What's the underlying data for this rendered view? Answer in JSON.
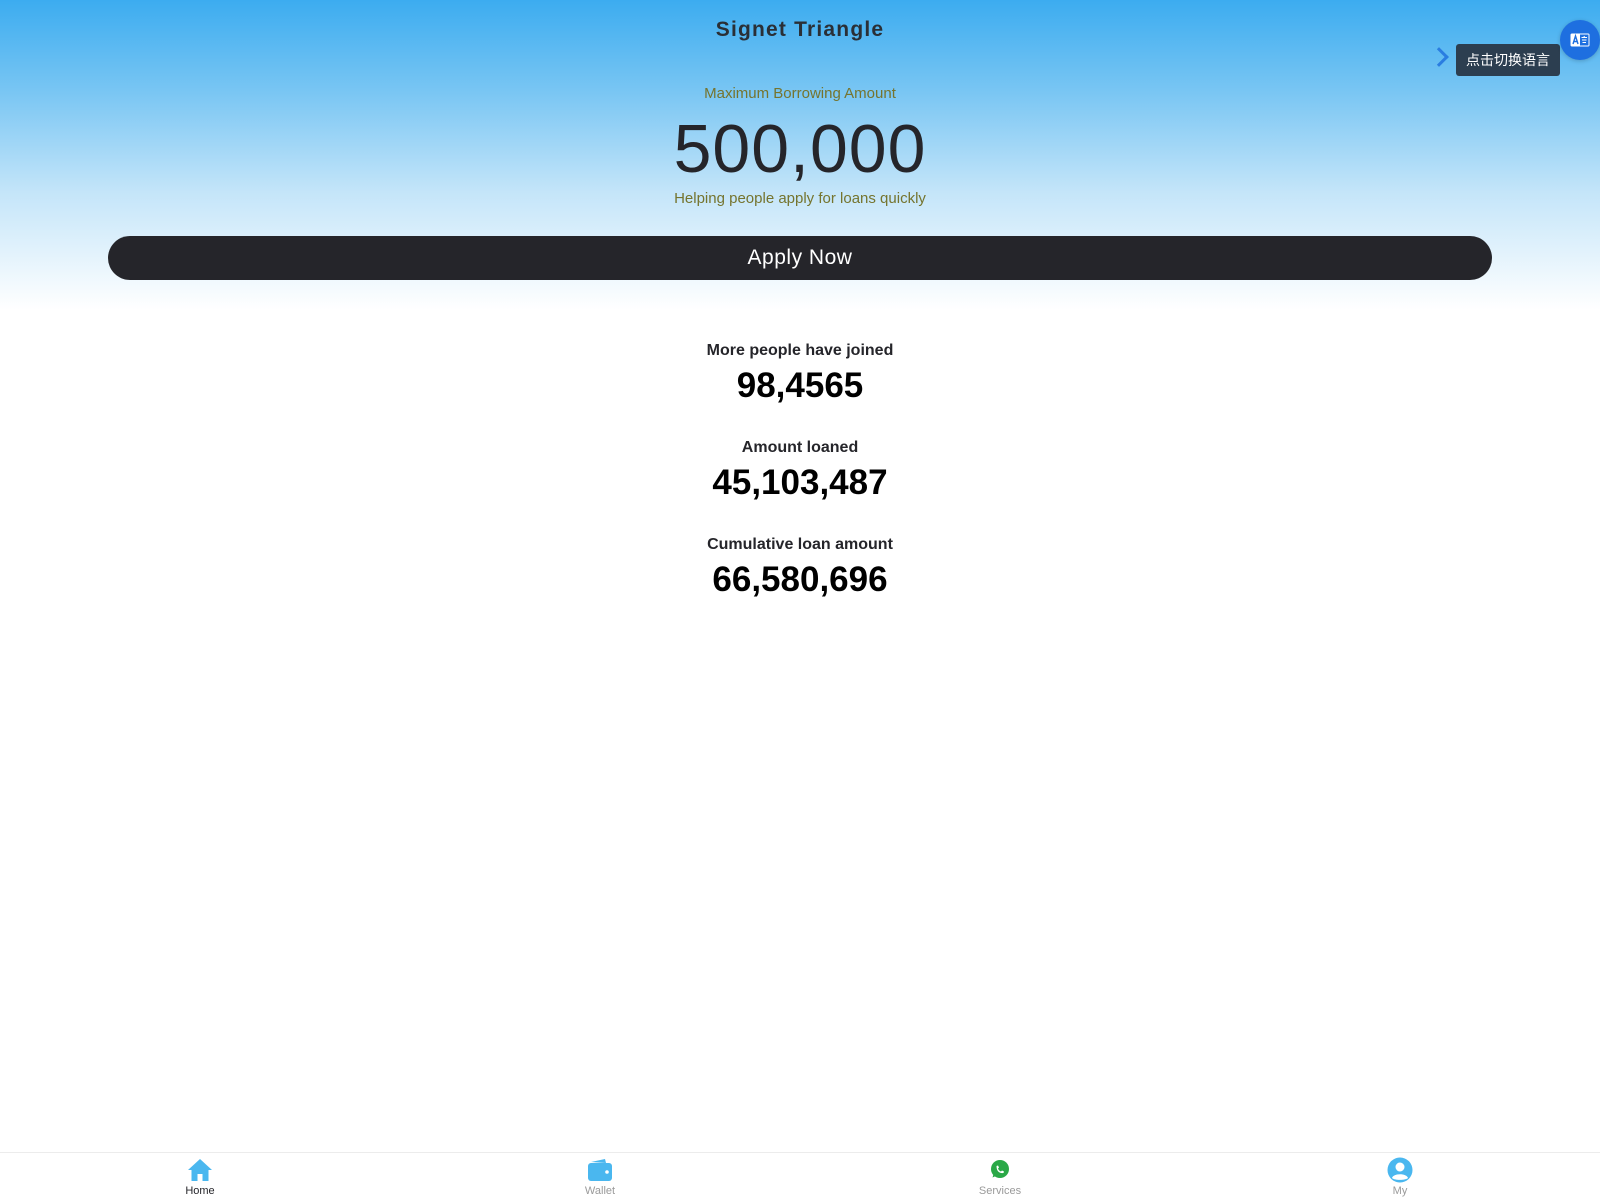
{
  "header": {
    "title": "Signet Triangle"
  },
  "hero": {
    "max_label": "Maximum Borrowing Amount",
    "max_amount": "500,000",
    "tagline": "Helping people apply for loans quickly",
    "apply_label": "Apply Now"
  },
  "language": {
    "tooltip": "点击切换语言",
    "icon": "translate-icon"
  },
  "stats": [
    {
      "label": "More people have joined",
      "value": "98,4565"
    },
    {
      "label": "Amount loaned",
      "value": "45,103,487"
    },
    {
      "label": "Cumulative loan amount",
      "value": "66,580,696"
    }
  ],
  "tabbar": {
    "items": [
      {
        "label": "Home",
        "icon": "home-icon",
        "active": true
      },
      {
        "label": "Wallet",
        "icon": "wallet-icon",
        "active": false
      },
      {
        "label": "Services",
        "icon": "whatsapp-icon",
        "active": false
      },
      {
        "label": "My",
        "icon": "user-icon",
        "active": false
      }
    ]
  },
  "colors": {
    "accent_blue": "#3cacf0",
    "button_dark": "#25252a",
    "label_olive": "#75742e",
    "icon_blue": "#4ab7ef",
    "whatsapp_green": "#2aa847"
  }
}
